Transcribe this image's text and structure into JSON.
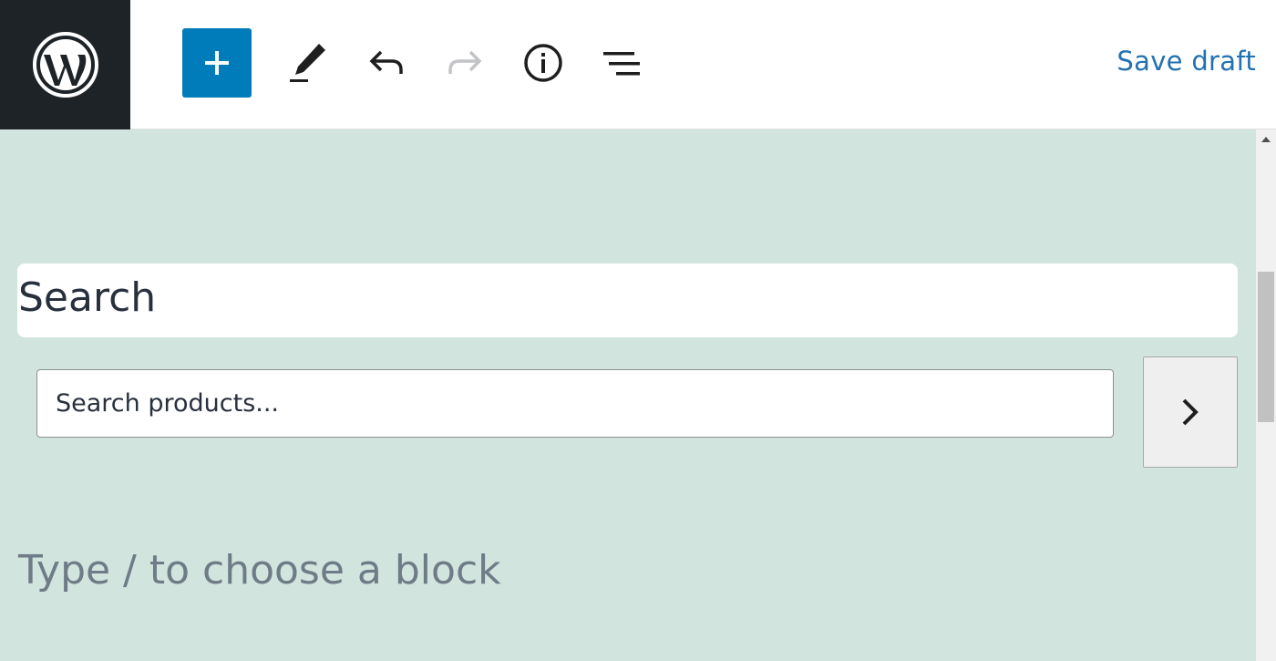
{
  "toolbar": {
    "logo_icon": "wordpress-logo",
    "add_block_icon": "plus-icon",
    "tools_icon": "pencil-icon",
    "undo_icon": "undo-icon",
    "redo_icon": "redo-icon",
    "details_icon": "info-icon",
    "list_view_icon": "list-view-icon",
    "save_draft_label": "Save draft",
    "accent_color": "#007cba",
    "logo_bg_color": "#1e2327"
  },
  "editor": {
    "background_color": "#d1e4dd",
    "heading": "Search",
    "search": {
      "placeholder": "Search products...",
      "submit_icon": "chevron-right-icon"
    },
    "block_placeholder": "Type / to choose a block"
  }
}
